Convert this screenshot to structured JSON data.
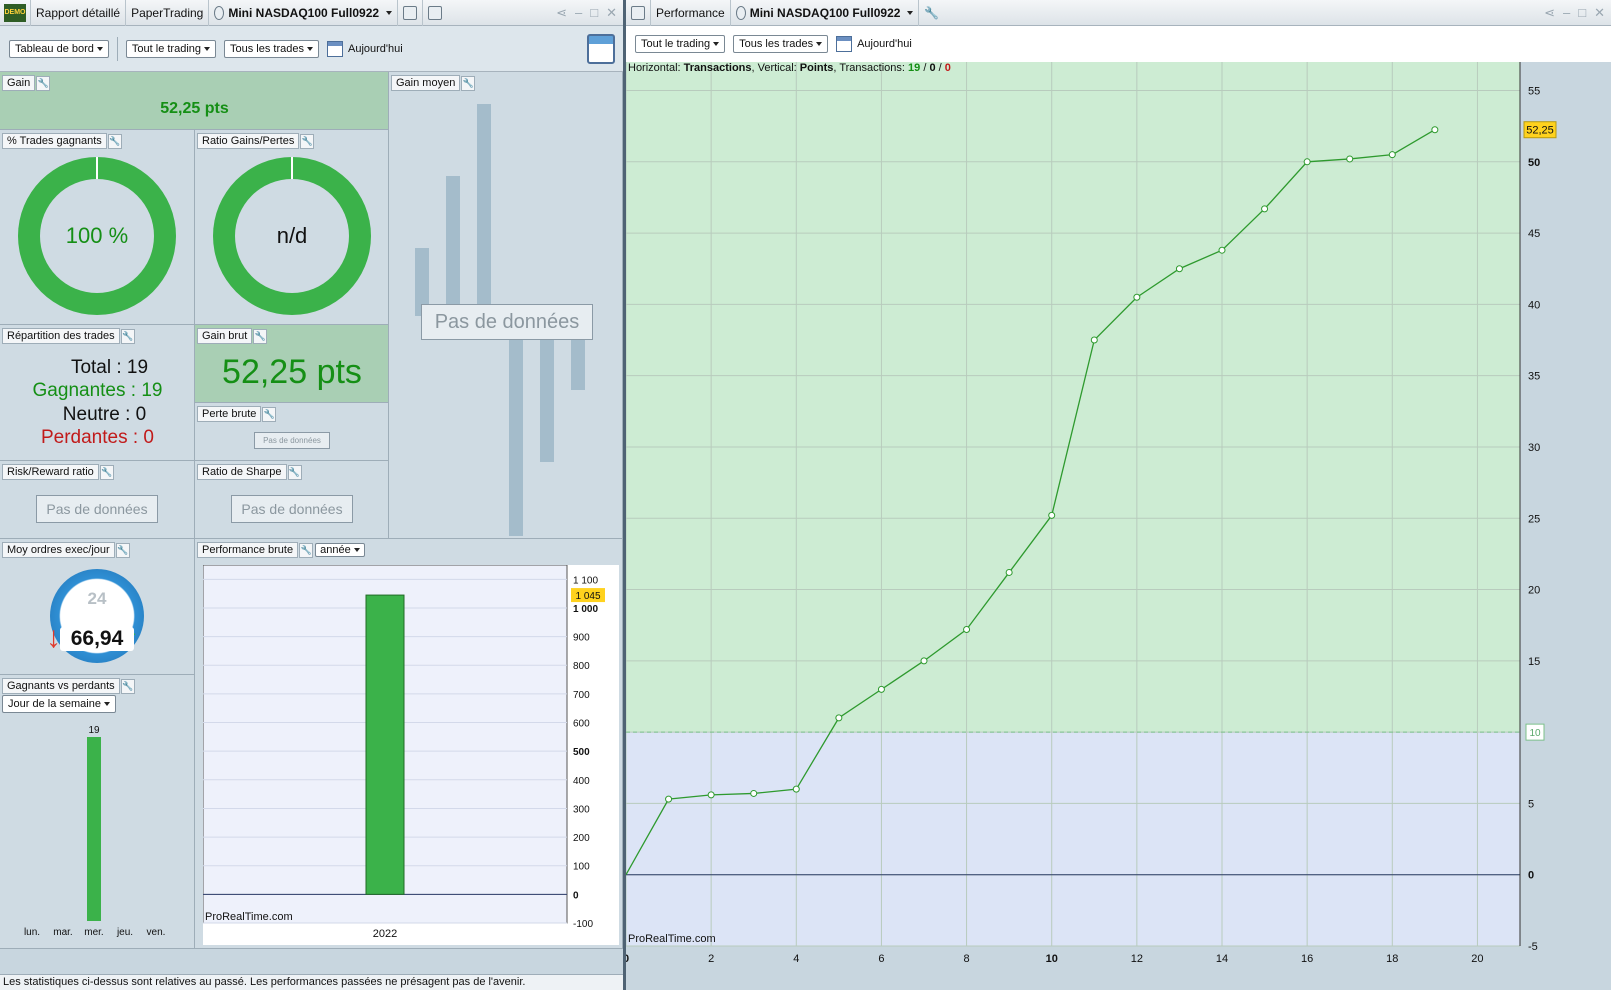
{
  "left_window": {
    "tabs": [
      "Rapport détaillé",
      "PaperTrading",
      "Mini NASDAQ100 Full0922"
    ],
    "toolbar": {
      "dashboard": "Tableau de bord",
      "scope": "Tout le trading",
      "trades": "Tous les trades",
      "date": "Aujourd'hui"
    }
  },
  "right_window": {
    "tabs": [
      "Performance",
      "Mini NASDAQ100 Full0922"
    ],
    "toolbar": {
      "scope": "Tout le trading",
      "trades": "Tous les trades",
      "date": "Aujourd'hui"
    }
  },
  "panels": {
    "gain": {
      "label": "Gain",
      "value": "52,25 pts"
    },
    "gain_moyen": {
      "label": "Gain moyen",
      "nodata": "Pas de données"
    },
    "pct_gagnants": {
      "label": "% Trades gagnants",
      "value": "100 %"
    },
    "ratio_gp": {
      "label": "Ratio Gains/Pertes",
      "value": "n/d"
    },
    "repartition": {
      "label": "Répartition des trades",
      "total": "Total : 19",
      "gagnantes": "Gagnantes : 19",
      "neutre": "Neutre : 0",
      "perdantes": "Perdantes : 0"
    },
    "gain_brut": {
      "label": "Gain brut",
      "value": "52,25 pts"
    },
    "perte_brute": {
      "label": "Perte brute",
      "nodata": "Pas de données"
    },
    "risk_reward": {
      "label": "Risk/Reward ratio",
      "nodata": "Pas de données"
    },
    "sharpe": {
      "label": "Ratio de Sharpe",
      "nodata": "Pas de données"
    },
    "moy_ordres": {
      "label": "Moy ordres exec/jour",
      "value": "66,94",
      "dial": "24"
    },
    "perf_brute": {
      "label": "Performance brute",
      "period": "année"
    },
    "gvp": {
      "label": "Gagnants vs perdants",
      "selector": "Jour de la semaine"
    }
  },
  "footer": "Les statistiques ci-dessus sont relatives au passé. Les performances passées ne présagent pas de l'avenir.",
  "colors": {
    "green": "#3bb24a",
    "bar_grey": "#9db7c7",
    "perf_bg": "#cdecd3",
    "perf_zone_low": "#dce4f6"
  },
  "chart_data": [
    {
      "type": "line",
      "title": "",
      "header": {
        "h_label": "Horizontal:",
        "h_value": "Transactions",
        "v_label": "Vertical:",
        "v_value": "Points",
        "t_label": "Transactions:",
        "t_win": "19",
        "t_neutral": "0",
        "t_loss": "0"
      },
      "x": [
        0,
        1,
        2,
        3,
        4,
        5,
        6,
        7,
        8,
        9,
        10,
        11,
        12,
        13,
        14,
        15,
        16,
        17,
        18,
        19
      ],
      "y": [
        0,
        5.3,
        5.6,
        5.7,
        6.0,
        11.0,
        13.0,
        15.0,
        17.2,
        21.2,
        25.2,
        37.5,
        40.5,
        42.5,
        43.8,
        46.7,
        50.0,
        50.2,
        50.5,
        52.25
      ],
      "xlim": [
        0,
        21
      ],
      "ylim": [
        -5,
        57
      ],
      "x_ticks": [
        0,
        2,
        4,
        6,
        8,
        10,
        12,
        14,
        16,
        18,
        20
      ],
      "y_ticks": [
        -5,
        0,
        5,
        10,
        15,
        20,
        25,
        30,
        35,
        40,
        45,
        50,
        55
      ],
      "last_value_label": "52,25",
      "threshold_label": "10",
      "threshold": 10,
      "watermark": "ProRealTime.com"
    },
    {
      "type": "bar",
      "categories": [
        "2022"
      ],
      "values": [
        1045
      ],
      "ylim": [
        -100,
        1150
      ],
      "y_ticks": [
        -100,
        0,
        100,
        200,
        300,
        400,
        500,
        600,
        700,
        800,
        900,
        1000,
        1100
      ],
      "y_tick_labels": [
        "-100",
        "0",
        "100",
        "200",
        "300",
        "400",
        "500",
        "600",
        "700",
        "800",
        "900",
        "1 000",
        "1 100"
      ],
      "value_label": "1 045",
      "watermark": "ProRealTime.com"
    },
    {
      "type": "bar",
      "categories": [
        "lun.",
        "mar.",
        "mer.",
        "jeu.",
        "ven."
      ],
      "values": [
        0,
        0,
        19,
        0,
        0
      ],
      "data_label": "19"
    }
  ]
}
